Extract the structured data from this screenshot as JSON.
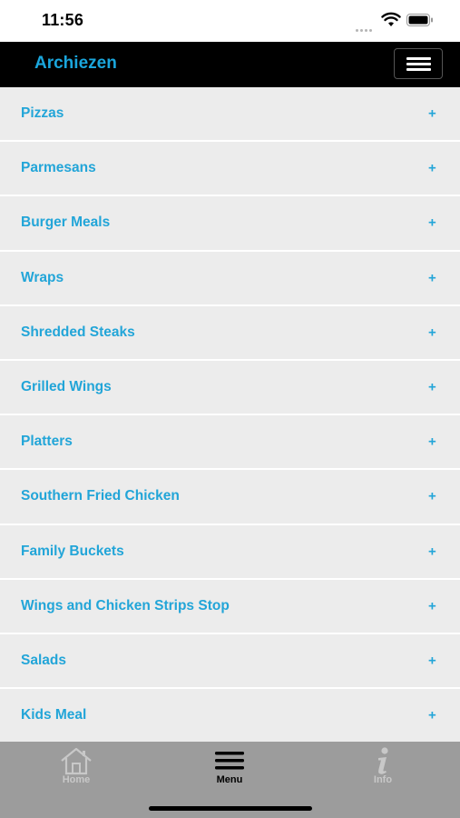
{
  "status_bar": {
    "time": "11:56"
  },
  "header": {
    "title": "Archiezen"
  },
  "categories": [
    {
      "label": "Pizzas"
    },
    {
      "label": "Parmesans"
    },
    {
      "label": "Burger Meals"
    },
    {
      "label": "Wraps"
    },
    {
      "label": "Shredded Steaks"
    },
    {
      "label": "Grilled Wings"
    },
    {
      "label": "Platters"
    },
    {
      "label": "Southern Fried Chicken"
    },
    {
      "label": "Family Buckets"
    },
    {
      "label": "Wings and Chicken Strips Stop"
    },
    {
      "label": "Salads"
    },
    {
      "label": "Kids Meal"
    }
  ],
  "expand_symbol": "+",
  "tab_bar": {
    "home": {
      "label": "Home",
      "icon": "house-icon"
    },
    "menu": {
      "label": "Menu",
      "icon": "menu-lines-icon"
    },
    "info": {
      "label": "Info",
      "icon": "info-icon"
    },
    "active": "menu"
  },
  "colors": {
    "accent": "#22a5d8",
    "header_bg": "#000000",
    "item_bg": "#ececec",
    "tab_bar_bg": "#9c9c9c",
    "tab_inactive": "#c8c8c8"
  }
}
